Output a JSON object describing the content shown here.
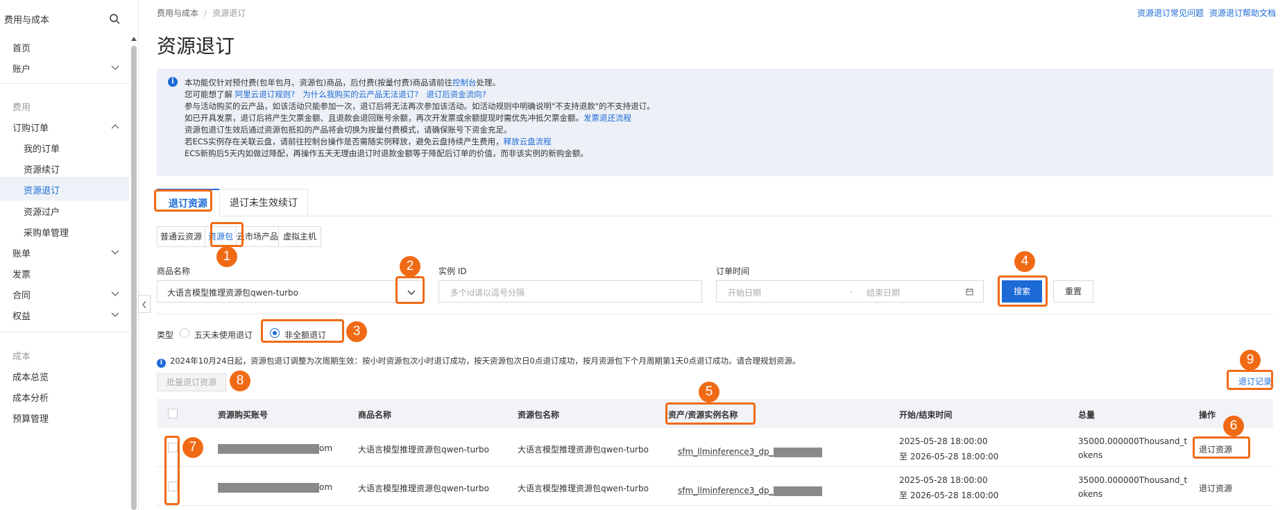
{
  "sidebar": {
    "title": "费用与成本",
    "items": [
      {
        "label": "首页"
      },
      {
        "label": "账户"
      },
      {
        "label": "费用"
      },
      {
        "label": "订购订单"
      },
      {
        "label": "我的订单"
      },
      {
        "label": "资源续订"
      },
      {
        "label": "资源退订"
      },
      {
        "label": "资源过户"
      },
      {
        "label": "采购单管理"
      },
      {
        "label": "账单"
      },
      {
        "label": "发票"
      },
      {
        "label": "合同"
      },
      {
        "label": "权益"
      },
      {
        "label": "成本"
      },
      {
        "label": "成本总览"
      },
      {
        "label": "成本分析"
      },
      {
        "label": "预算管理"
      }
    ]
  },
  "breadcrumb": {
    "parent": "费用与成本",
    "current": "资源退订"
  },
  "top_links": {
    "faq": "资源退订常见问题",
    "help": "资源退订帮助文档"
  },
  "page_title": "资源退订",
  "notice": {
    "line1_a": "本功能仅针对预付费(包年包月、资源包)商品，后付费(按量付费)商品请前往",
    "line1_link": "控制台",
    "line1_b": "处理。",
    "line2_a": "您可能想了解",
    "line2_l1": "阿里云退订规则?",
    "line2_l2": "为什么我购买的云产品无法退订?",
    "line2_l3": "退订后资金流向?",
    "line3": "参与活动购买的云产品，如该活动只能参加一次，退订后将无法再次参加该活动。如活动规则中明确说明\"不支持退款\"的不支持退订。",
    "line4_a": "如已开具发票，退订后将产生欠票金额、且退款会退回账号余额，再次开发票或余额提现时需优先冲抵欠票金额。",
    "line4_link": "发票退还流程",
    "line5": "资源包退订生效后通过资源包抵扣的产品将会切换为按量付费模式，请确保账号下资金充足。",
    "line6_a": "若ECS实例存在关联云盘，请前往控制台操作是否需随实例释放，避免云盘持续产生费用，",
    "line6_link": "释放云盘流程",
    "line7": "ECS新购后5天内如做过降配，再操作五天无理由退订时退款金额等于降配后订单的价值，而非该实例的新购金额。"
  },
  "tabs": {
    "tab1": "退订资源",
    "tab2": "退订未生效续订"
  },
  "subtabs": {
    "s1": "普通云资源",
    "s2": "资源包",
    "s3": "云市场产品",
    "s4": "虚拟主机"
  },
  "filters": {
    "product_label": "商品名称",
    "product_value": "大语言模型推理资源包qwen-turbo",
    "instance_label": "实例 ID",
    "instance_placeholder": "多个id请以逗号分隔",
    "time_label": "订单时间",
    "start_placeholder": "开始日期",
    "end_placeholder": "结束日期",
    "range_sep": "-",
    "search": "搜索",
    "reset": "重置",
    "type_label": "类型",
    "radio1": "五天未使用退订",
    "radio2": "非全额退订"
  },
  "info_text": "2024年10月24日起，资源包退订调整为次周期生效：按小时资源包次小时退订成功，按天资源包次日0点退订成功，按月资源包下个月周期第1天0点退订成功。请合理规划资源。",
  "batch_button": "批量退订资源",
  "history_link": "退订记录",
  "table": {
    "headers": [
      "资源购买账号",
      "商品名称",
      "资源包名称",
      "资产/资源实例名称",
      "开始/结束时间",
      "总量",
      "操作"
    ],
    "rows": [
      {
        "account_tail": "om",
        "product": "大语言模型推理资源包qwen-turbo",
        "package": "大语言模型推理资源包qwen-turbo",
        "instance": "sfm_llminference3_dp_",
        "start": "2025-05-28 18:00:00",
        "end": "至 2026-05-28 18:00:00",
        "total_a": "35000.000000Thousand_t",
        "total_b": "okens",
        "action": "退订资源"
      },
      {
        "account_tail": "om",
        "product": "大语言模型推理资源包qwen-turbo",
        "package": "大语言模型推理资源包qwen-turbo",
        "instance": "sfm_llminference3_dp_",
        "start": "2025-05-28 18:00:00",
        "end": "至 2026-05-28 18:00:00",
        "total_a": "35000.000000Thousand_t",
        "total_b": "okens",
        "action": "退订资源"
      }
    ]
  },
  "annotations": [
    "1",
    "2",
    "3",
    "4",
    "5",
    "6",
    "7",
    "8",
    "9"
  ],
  "colors": {
    "accent": "#1b6ad6",
    "annotation": "#f06a15",
    "notice_bg": "#edf1f7"
  }
}
